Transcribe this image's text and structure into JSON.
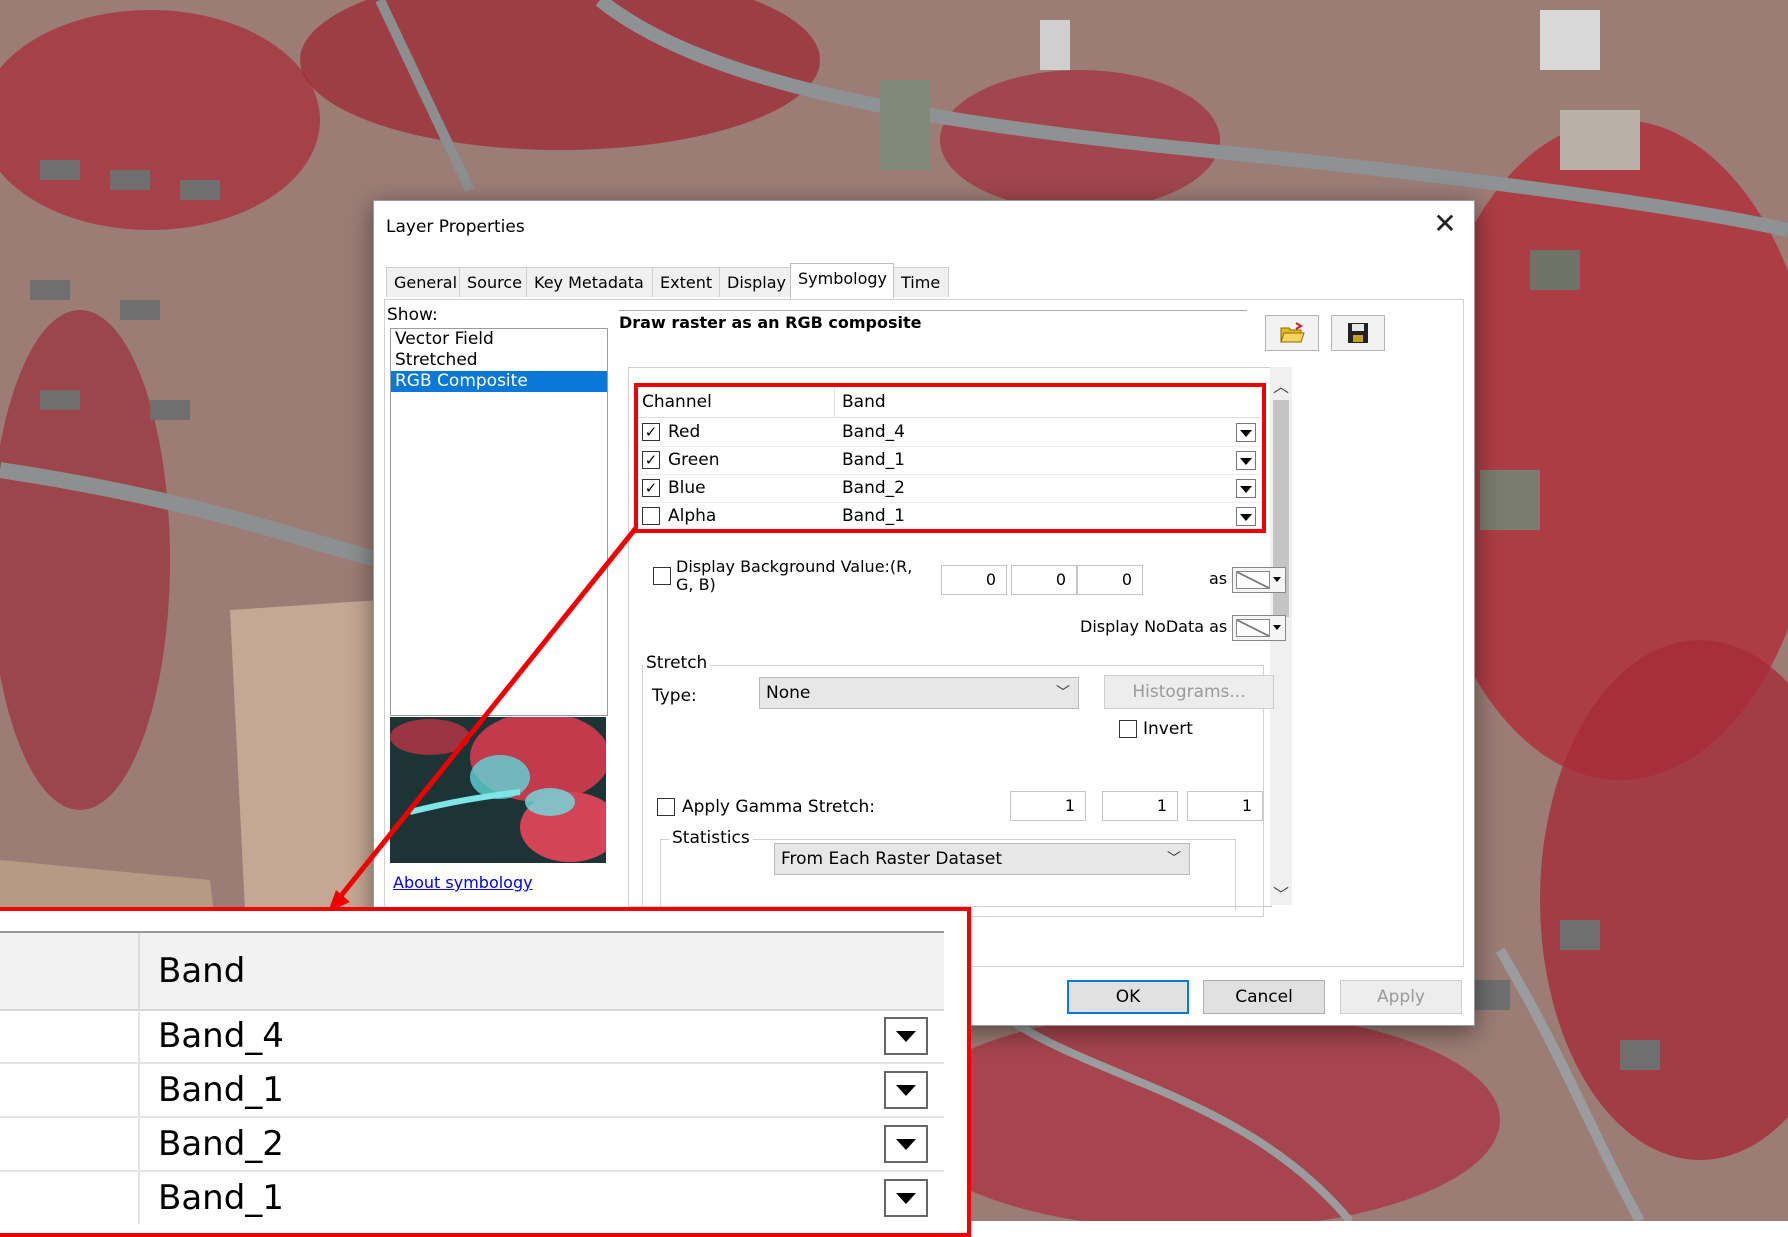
{
  "dialog": {
    "title": "Layer Properties",
    "close_glyph": "✕",
    "tabs": [
      "General",
      "Source",
      "Key Metadata",
      "Extent",
      "Display",
      "Symbology",
      "Time"
    ],
    "active_tab": "Symbology"
  },
  "show_panel": {
    "label": "Show:",
    "items": [
      "Vector Field",
      "Stretched",
      "RGB Composite"
    ],
    "selected": "RGB Composite",
    "about_link": "About symbology"
  },
  "symbology": {
    "heading": "Draw raster as an RGB composite",
    "open_icon": "folder-open-icon",
    "save_icon": "save-icon",
    "channel_table": {
      "headers": [
        "Channel",
        "Band"
      ],
      "rows": [
        {
          "channel": "Red",
          "checked": true,
          "band": "Band_4"
        },
        {
          "channel": "Green",
          "checked": true,
          "band": "Band_1"
        },
        {
          "channel": "Blue",
          "checked": true,
          "band": "Band_2"
        },
        {
          "channel": "Alpha",
          "checked": false,
          "band": "Band_1"
        }
      ]
    },
    "background": {
      "label": "Display Background Value:(R, G, B)",
      "values": [
        "0",
        "0",
        "0"
      ],
      "as_label": "as"
    },
    "nodata_label": "Display NoData as",
    "stretch": {
      "group_label": "Stretch",
      "type_label": "Type:",
      "type_value": "None",
      "histograms_button": "Histograms...",
      "invert_label": "Invert"
    },
    "gamma": {
      "label": "Apply Gamma Stretch:",
      "values": [
        "1",
        "1",
        "1"
      ]
    },
    "statistics": {
      "group_label": "Statistics",
      "value": "From Each Raster Dataset"
    }
  },
  "buttons": {
    "ok": "OK",
    "cancel": "Cancel",
    "apply": "Apply"
  },
  "zoom_inset": {
    "header": "Band",
    "bands": [
      "Band_4",
      "Band_1",
      "Band_2",
      "Band_1"
    ]
  },
  "colors": {
    "highlight_red": "#ee0000",
    "selection_blue": "#0a78d7",
    "vegetation_red": "#c2303c"
  }
}
